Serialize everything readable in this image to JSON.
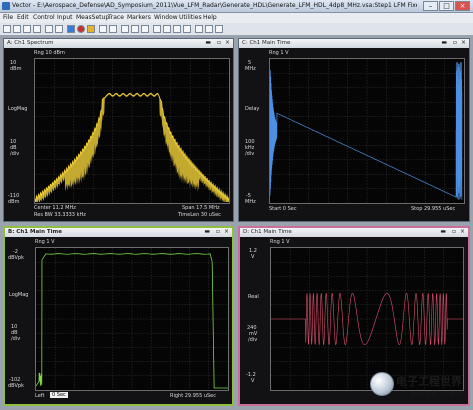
{
  "window": {
    "title": "Vector - E:\\Aerospace_Defense\\AD_Symposium_2011\\Vue_LFM_Radar\\Generate_HDL\\Generate_LFM_HDL_4dp8_MHz.vsa:Step1 LFM Fixed Point L..."
  },
  "menu": [
    "File",
    "Edit",
    "Control",
    "Input",
    "MeasSetup",
    "Trace",
    "Markers",
    "Window",
    "Utilities",
    "Help"
  ],
  "panels": {
    "a": {
      "tab": "A: Ch1 Spectrum",
      "ref": "Rng 10 dBm",
      "top_val": "10",
      "top_unit": "dBm",
      "scale_name": "LogMag",
      "scale_val": "10",
      "scale_unit": "dB",
      "scale_div": "/div",
      "bottom_val": "-110",
      "bottom_unit": "dBm",
      "center": "Center 11.2 MHz",
      "span": "Span 17.5 MHz",
      "rbw": "Res BW 33.3333 kHz",
      "timelen": "TimeLen 30 uSec"
    },
    "c": {
      "tab": "C: Ch1 Main Time",
      "ref": "Rng 1 V",
      "top_val": "5",
      "top_unit": "MHz",
      "scale_name": "Delay",
      "scale_val": "100",
      "scale_unit": "kHz",
      "scale_div": "/div",
      "bottom_val": "-5",
      "bottom_unit": "MHz",
      "start": "Start 0 Sec",
      "stop": "Stop 29.955 uSec"
    },
    "b": {
      "tab": "B: Ch1 Main Time",
      "ref": "Rng 1 V",
      "top_val": "-2",
      "top_unit": "dBVpk",
      "scale_name": "LogMag",
      "scale_val": "10",
      "scale_unit": "dB",
      "scale_div": "/div",
      "bottom_val": "-102",
      "bottom_unit": "dBVpk",
      "left": "Left",
      "left_val": "0 Sec",
      "right": "Right 29.955 uSec"
    },
    "d": {
      "tab": "D: Ch1 Main Time",
      "ref": "Rng 1 V",
      "top_val": "1.2",
      "top_unit": "V",
      "scale_name": "Real",
      "scale_val": "240",
      "scale_unit": "mV",
      "scale_div": "/div",
      "bottom_val": "-1.2",
      "bottom_unit": "V"
    }
  },
  "watermark": {
    "title": "电子工程世界",
    "url": "eeworld.com.cn"
  },
  "colors": {
    "spectrum": "#f4d23a",
    "delay": "#4d8fe0",
    "logmag_time": "#7ed84a",
    "real": "#e0506f",
    "plot_bg": "#050505",
    "panel_bg": "#121214"
  },
  "icons": [
    "app-icon",
    "minimize-icon",
    "maximize-icon",
    "close-icon",
    "panel-minimize-icon",
    "panel-maximize-icon",
    "panel-close-icon"
  ]
}
